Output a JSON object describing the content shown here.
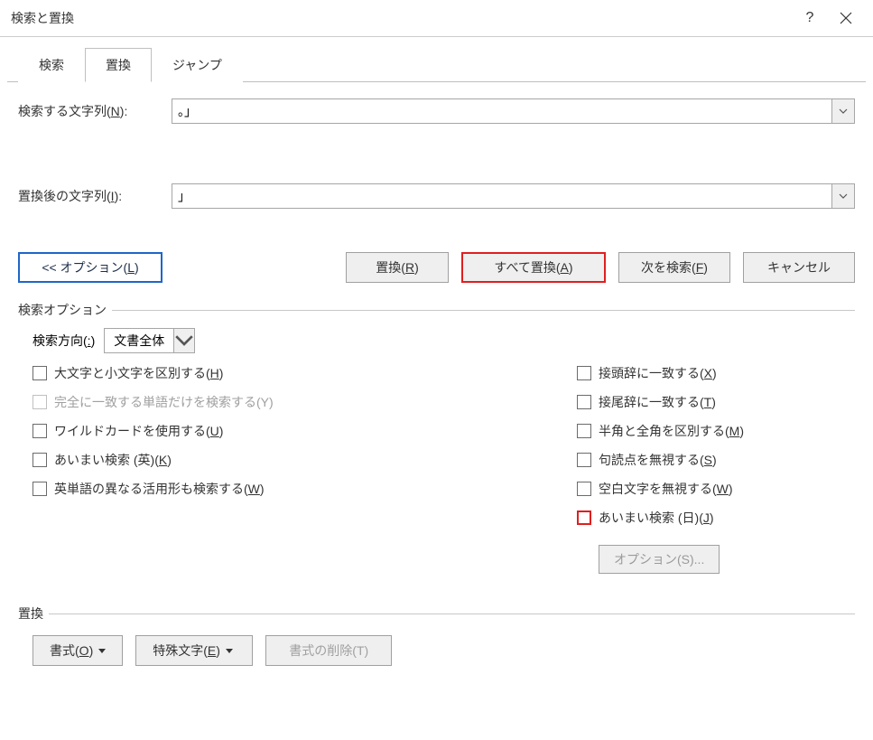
{
  "window": {
    "title": "検索と置換"
  },
  "tabs": {
    "search": "検索",
    "replace": "置換",
    "jump": "ジャンプ",
    "active": "replace"
  },
  "fields": {
    "find_label_pre": "検索する文字列(",
    "find_label_key": "N",
    "find_label_post": "):",
    "find_value": "。」",
    "replace_label_pre": "置換後の文字列(",
    "replace_label_key": "I",
    "replace_label_post": "):",
    "replace_value": "」"
  },
  "buttons": {
    "options_pre": "<< オプション(",
    "options_key": "L",
    "options_post": ")",
    "replace_pre": "置換(",
    "replace_key": "R",
    "replace_post": ")",
    "replace_all_pre": "すべて置換(",
    "replace_all_key": "A",
    "replace_all_post": ")",
    "find_next_pre": "次を検索(",
    "find_next_key": "F",
    "find_next_post": ")",
    "cancel": "キャンセル"
  },
  "options_group_title": "検索オプション",
  "direction": {
    "label_pre": "検索方向(",
    "label_key": ":",
    "label_post": ")",
    "value": "文書全体"
  },
  "checks_left": {
    "case_pre": "大文字と小文字を区別する(",
    "case_key": "H",
    "case_post": ")",
    "whole_pre": "完全に一致する単語だけを検索する(Y)",
    "wildcard_pre": "ワイルドカードを使用する(",
    "wildcard_key": "U",
    "wildcard_post": ")",
    "fuzzy_en_pre": "あいまい検索 (英)(",
    "fuzzy_en_key": "K",
    "fuzzy_en_post": ")",
    "wordforms_pre": "英単語の異なる活用形も検索する(",
    "wordforms_key": "W",
    "wordforms_post": ")"
  },
  "checks_right": {
    "prefix_pre": "接頭辞に一致する(",
    "prefix_key": "X",
    "prefix_post": ")",
    "suffix_pre": "接尾辞に一致する(",
    "suffix_key": "T",
    "suffix_post": ")",
    "width_pre": "半角と全角を区別する(",
    "width_key": "M",
    "width_post": ")",
    "punct_pre": "句読点を無視する(",
    "punct_key": "S",
    "punct_post": ")",
    "white_pre": "空白文字を無視する(",
    "white_key": "W",
    "white_post": ")",
    "fuzzy_jp_pre": "あいまい検索 (日)(",
    "fuzzy_jp_key": "J",
    "fuzzy_jp_post": ")",
    "options_btn": "オプション(S)..."
  },
  "replace_group_title": "置換",
  "bottom_buttons": {
    "format_pre": "書式(",
    "format_key": "O",
    "format_post": ")",
    "special_pre": "特殊文字(",
    "special_key": "E",
    "special_post": ")",
    "clearfmt": "書式の削除(T)"
  }
}
